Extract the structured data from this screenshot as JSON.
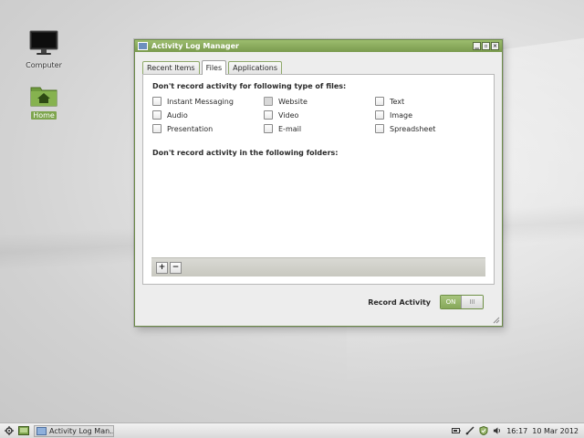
{
  "desktop": {
    "icons": [
      {
        "label": "Computer",
        "icon": "monitor-icon"
      },
      {
        "label": "Home",
        "icon": "home-folder-icon"
      }
    ]
  },
  "window": {
    "title": "Activity Log Manager",
    "buttons": [
      "minimize-icon",
      "maximize-icon",
      "close-icon"
    ],
    "tabs": [
      {
        "label": "Recent Items"
      },
      {
        "label": "Files"
      },
      {
        "label": "Applications"
      }
    ],
    "active_tab": "Files",
    "files_section_title": "Don't record activity for following type of files:",
    "file_types": [
      {
        "label": "Instant Messaging",
        "checked": false
      },
      {
        "label": "Website",
        "checked": false
      },
      {
        "label": "Text",
        "checked": false
      },
      {
        "label": "Audio",
        "checked": false
      },
      {
        "label": "Video",
        "checked": false
      },
      {
        "label": "Image",
        "checked": false
      },
      {
        "label": "Presentation",
        "checked": false
      },
      {
        "label": "E-mail",
        "checked": false
      },
      {
        "label": "Spreadsheet",
        "checked": false
      }
    ],
    "folders_section_title": "Don't record activity in the following folders:",
    "folder_add": "+",
    "folder_remove": "−",
    "record_activity_label": "Record Activity",
    "toggle_on_text": "ON",
    "toggle_knob_text": "III"
  },
  "taskbar": {
    "menu_icon": "gear-icon",
    "show_desktop_icon": "show-desktop-icon",
    "task_label": "Activity Log Man...",
    "tray_icons": [
      "battery-icon",
      "network-icon",
      "shield-icon",
      "volume-icon"
    ],
    "time": "16:17",
    "date": "10 Mar 2012"
  },
  "colors": {
    "accent": "#7ea54e",
    "title_bar": "#8aab5e"
  }
}
